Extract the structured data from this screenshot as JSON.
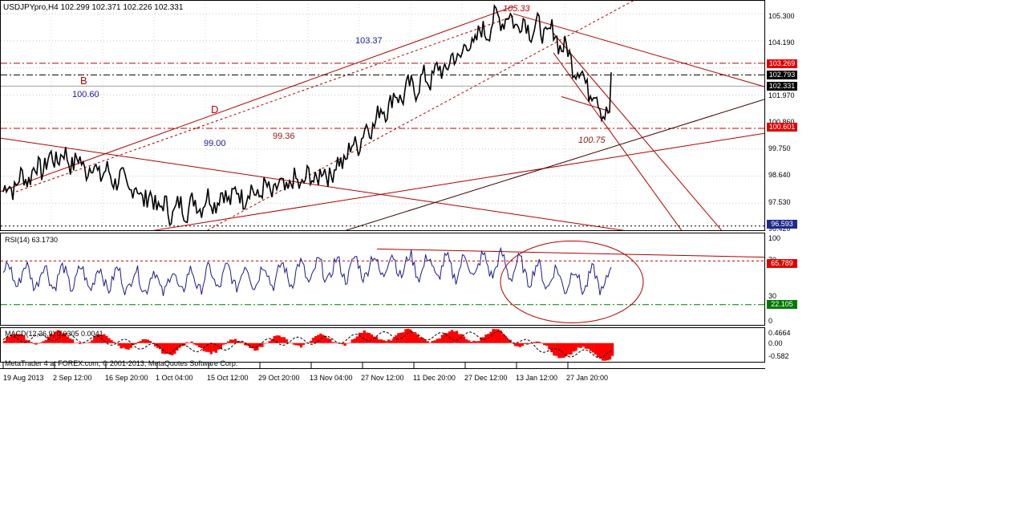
{
  "header": {
    "symbol_info": "USDJPYpro,H4  102.299 102.371 102.226 102.331"
  },
  "rsi": {
    "title": "RSI(14) 63.1730",
    "scale": [
      "100",
      "70",
      "30",
      "0"
    ]
  },
  "macd": {
    "title": "MACD(12,26,9) 0.0305 0.0041",
    "scale": [
      "0.4664",
      "0.00",
      "-0.582"
    ]
  },
  "footer": {
    "copyright": "MetaTrader 4 at FOREX.com, © 2001-2013, MetaQuotes Software Corp."
  },
  "price_scale": [
    "105.300",
    "104.190",
    "101.970",
    "100.860",
    "99.750",
    "98.640",
    "97.530",
    "96.420"
  ],
  "price_tags": [
    {
      "text": "103.269",
      "bg": "#e00000",
      "fg": "#ffffff",
      "value": 103.269
    },
    {
      "text": "102.793",
      "bg": "#000000",
      "fg": "#ffffff",
      "value": 102.793
    },
    {
      "text": "102.331",
      "bg": "#000000",
      "fg": "#ffffff",
      "value": 102.331
    },
    {
      "text": "100.601",
      "bg": "#e00000",
      "fg": "#ffffff",
      "value": 100.601
    },
    {
      "text": "96.593",
      "bg": "#1e2a8c",
      "fg": "#ffffff",
      "value": 96.593
    }
  ],
  "rsi_tags": [
    {
      "text": "65.789",
      "bg": "#e00000",
      "fg": "#ffffff",
      "value": 65.789
    },
    {
      "text": "22.105",
      "bg": "#007a00",
      "fg": "#ffffff",
      "value": 22.105
    }
  ],
  "time_axis": [
    "19 Aug 2013",
    "2 Sep 12:00",
    "16 Sep 20:00",
    "1 Oct 04:00",
    "15 Oct 12:00",
    "29 Oct 20:00",
    "13 Nov 04:00",
    "27 Nov 12:00",
    "11 Dec 20:00",
    "27 Dec 12:00",
    "13 Jan 12:00",
    "27 Jan 20:00"
  ],
  "annotations": [
    {
      "text": "105.33",
      "color": "#c00000",
      "italic": true,
      "value": 105.33
    },
    {
      "text": "103.37",
      "color": "#1a1aa0",
      "italic": false,
      "value": 103.37
    },
    {
      "text": "B",
      "color": "#c00000",
      "italic": false
    },
    {
      "text": "100.60",
      "color": "#1a1aa0",
      "italic": false,
      "value": 100.6
    },
    {
      "text": "D",
      "color": "#c00000",
      "italic": false
    },
    {
      "text": "99.00",
      "color": "#1a1aa0",
      "italic": false,
      "value": 99.0
    },
    {
      "text": "99.36",
      "color": "#8b1a1a",
      "italic": false,
      "value": 99.36
    },
    {
      "text": "100.75",
      "color": "#8b1a1a",
      "italic": true,
      "value": 100.75
    }
  ],
  "chart_data": [
    {
      "type": "line",
      "panel": "price",
      "series_label": "USDJPYpro,H4",
      "ylim": [
        96.42,
        105.8
      ],
      "x": [
        "19 Aug 2013",
        "2 Sep 12:00",
        "16 Sep 20:00",
        "1 Oct 04:00",
        "15 Oct 12:00",
        "29 Oct 20:00",
        "13 Nov 04:00",
        "27 Nov 12:00",
        "11 Dec 20:00",
        "27 Dec 12:00",
        "13 Jan 12:00",
        "27 Jan 20:00"
      ],
      "values": [
        98.0,
        99.5,
        98.6,
        97.2,
        97.8,
        98.1,
        98.9,
        101.7,
        103.1,
        105.2,
        104.4,
        100.9
      ],
      "last": 102.331,
      "hlines": [
        103.269,
        102.793,
        100.601,
        96.593
      ],
      "colors": {
        "price": "#000000",
        "trend": "#b00000",
        "levels": "#c00000"
      }
    },
    {
      "type": "line",
      "panel": "rsi",
      "series_label": "RSI(14)",
      "ylim": [
        0,
        100
      ],
      "values": [
        55,
        52,
        50,
        46,
        52,
        55,
        60,
        66,
        62,
        66,
        50,
        48
      ],
      "last": 63.173,
      "levels": [
        65.789,
        22.105
      ],
      "colors": {
        "line": "#1a1a8c"
      }
    },
    {
      "type": "area",
      "panel": "macd",
      "series_label": "MACD(12,26,9)",
      "ylim": [
        -0.582,
        0.4664
      ],
      "values": [
        0.1,
        0.2,
        0.05,
        -0.2,
        -0.1,
        0.05,
        0.1,
        0.25,
        0.2,
        0.25,
        -0.3,
        -0.35
      ],
      "last": 0.0305,
      "signal_last": 0.0041,
      "colors": {
        "fill": "#ff0000",
        "signal": "#000000"
      }
    }
  ]
}
